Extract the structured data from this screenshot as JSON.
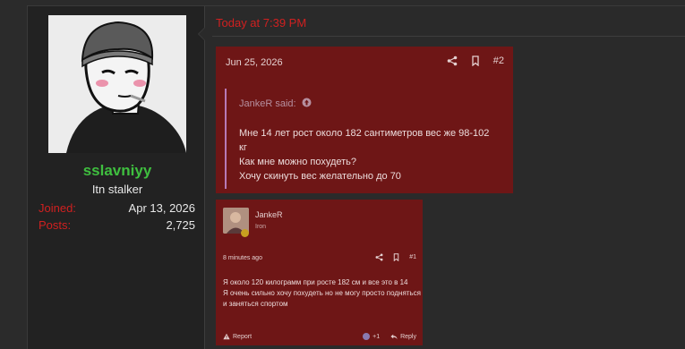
{
  "user": {
    "name": "sslavniyy",
    "title": "Itn stalker",
    "stats": [
      {
        "label": "Joined:",
        "value": "Apr 13, 2026"
      },
      {
        "label": "Posts:",
        "value": "2,725"
      }
    ]
  },
  "message": {
    "time": "Today at 7:39 PM",
    "embed1": {
      "date": "Jun 25, 2026",
      "post_number": "#2",
      "quote_author": "JankeR said:",
      "quote_lines": [
        "Мне 14 лет рост около 182 сантиметров вес же 98-102 кг",
        "Как мне можно похудеть?",
        "Хочу скинуть вес желательно до 70"
      ]
    },
    "embed2": {
      "author": "JankeR",
      "rank": "Iron",
      "time_ago": "8 minutes ago",
      "post_number": "#1",
      "text_lines": [
        "Я около 120 килограмм при росте 182 см и все это в 14",
        "Я очень сильно хочу похудеть но не могу просто подняться и заняться спортом"
      ],
      "report_label": "Report",
      "reaction_count": "+1",
      "reply_label": "Reply"
    }
  },
  "colors": {
    "accent_red": "#d02020",
    "username_green": "#3fbf3f",
    "embed_bg": "#6e1616"
  }
}
